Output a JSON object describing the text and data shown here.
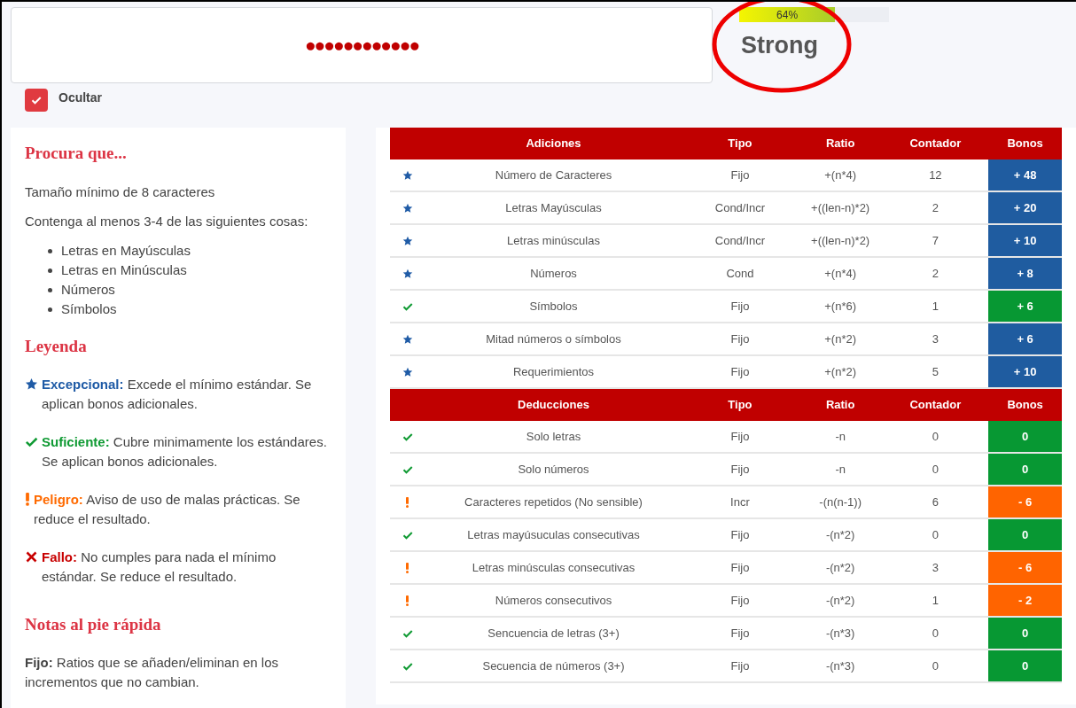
{
  "password": {
    "value": "●●●●●●●●●●●●"
  },
  "strength": {
    "level": 0.64,
    "reading": "64%",
    "label": "Strong"
  },
  "hide_toggle": {
    "label": "Ocultar",
    "checked": true
  },
  "guide": {
    "title": "Procura que...",
    "paragraphs": [
      "Tamaño mínimo de 8 caracteres",
      "Contenga al menos 3-4 de las siguientes cosas:"
    ],
    "list": [
      "Letras en Mayúsculas",
      "Letras en Minúsculas",
      "Números",
      "Símbolos"
    ],
    "legend_title": "Leyenda",
    "legend": [
      {
        "kind": "star",
        "term": "Excepcional:",
        "text": "Excede el mínimo estándar. Se aplican bonos adicionales."
      },
      {
        "kind": "check",
        "term": "Suficiente:",
        "text": "Cubre minimamente los estándares. Se aplican bonos adicionales."
      },
      {
        "kind": "warn",
        "term": "Peligro:",
        "text": "Aviso de uso de malas prácticas. Se reduce el resultado."
      },
      {
        "kind": "fail",
        "term": "Fallo:",
        "text": "No cumples para nada el mínimo estándar. Se reduce el resultado."
      }
    ],
    "notes_title": "Notas al pie rápida",
    "notes": [
      {
        "term": "Fijo:",
        "text": "Ratios que se añaden/eliminan en los incrementos que no cambian."
      }
    ]
  },
  "tables": [
    {
      "columns": [
        "Adiciones",
        "Tipo",
        "Ratio",
        "Contador",
        "Bonos"
      ],
      "rows": [
        {
          "kind": "star",
          "cells": [
            "Número de Caracteres",
            "Fijo",
            "+(n*4)",
            "12",
            "+ 48"
          ]
        },
        {
          "kind": "star",
          "cells": [
            "Letras Mayúsculas",
            "Cond/Incr",
            "+((len-n)*2)",
            "2",
            "+ 20"
          ]
        },
        {
          "kind": "star",
          "cells": [
            "Letras minúsculas",
            "Cond/Incr",
            "+((len-n)*2)",
            "7",
            "+ 10"
          ]
        },
        {
          "kind": "star",
          "cells": [
            "Números",
            "Cond",
            "+(n*4)",
            "2",
            "+ 8"
          ]
        },
        {
          "kind": "check",
          "cells": [
            "Símbolos",
            "Fijo",
            "+(n*6)",
            "1",
            "+ 6"
          ]
        },
        {
          "kind": "star",
          "cells": [
            "Mitad números o símbolos",
            "Fijo",
            "+(n*2)",
            "3",
            "+ 6"
          ]
        },
        {
          "kind": "star",
          "cells": [
            "Requerimientos",
            "Fijo",
            "+(n*2)",
            "5",
            "+ 10"
          ]
        }
      ]
    },
    {
      "columns": [
        "Deducciones",
        "Tipo",
        "Ratio",
        "Contador",
        "Bonos"
      ],
      "rows": [
        {
          "kind": "check",
          "cells": [
            "Solo letras",
            "Fijo",
            "-n",
            "0",
            "0"
          ]
        },
        {
          "kind": "check",
          "cells": [
            "Solo números",
            "Fijo",
            "-n",
            "0",
            "0"
          ]
        },
        {
          "kind": "warn",
          "cells": [
            "Caracteres repetidos (No sensible)",
            "Incr",
            "-(n(n-1))",
            "6",
            "- 6"
          ]
        },
        {
          "kind": "check",
          "cells": [
            "Letras mayúsuculas consecutivas",
            "Fijo",
            "-(n*2)",
            "0",
            "0"
          ]
        },
        {
          "kind": "warn",
          "cells": [
            "Letras minúsculas consecutivas",
            "Fijo",
            "-(n*2)",
            "3",
            "- 6"
          ]
        },
        {
          "kind": "warn",
          "cells": [
            "Números consecutivos",
            "Fijo",
            "-(n*2)",
            "1",
            "- 2"
          ]
        },
        {
          "kind": "check",
          "cells": [
            "Sencuencia de letras (3+)",
            "Fijo",
            "-(n*3)",
            "0",
            "0"
          ]
        },
        {
          "kind": "check",
          "cells": [
            "Secuencia de números (3+)",
            "Fijo",
            "-(n*3)",
            "0",
            "0"
          ]
        }
      ]
    }
  ]
}
